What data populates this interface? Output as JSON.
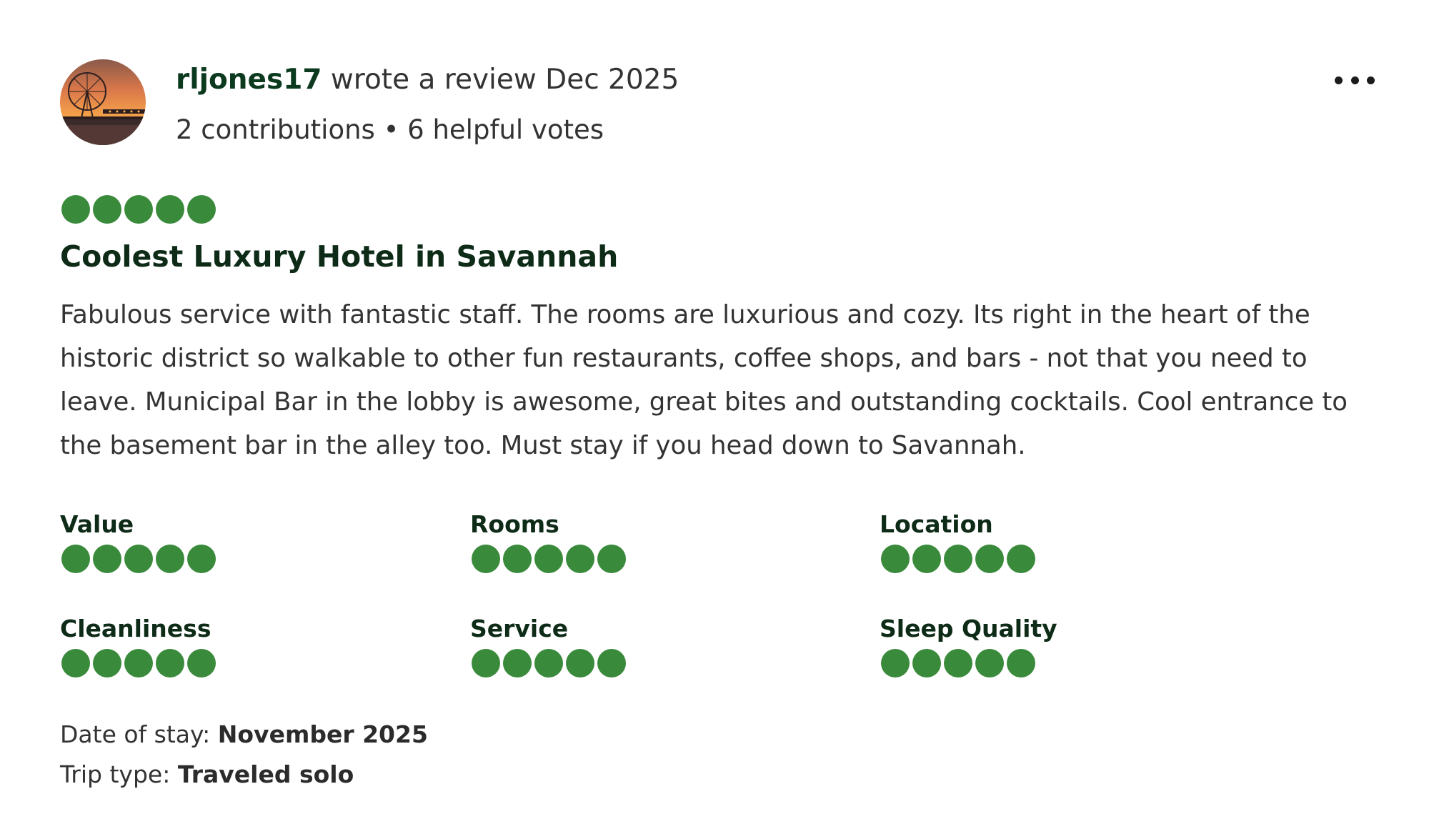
{
  "review": {
    "username": "rljones17",
    "wrote_text": "wrote a review Dec 2025",
    "contributions_text": "2 contributions • 6 helpful votes",
    "overall_rating": 5,
    "rating_max": 5,
    "title": "Coolest Luxury Hotel in Savannah",
    "body": "Fabulous service with fantastic staff. The rooms are luxurious and cozy. Its right in the heart of the historic district so walkable to other fun restaurants, coffee shops, and bars - not that you need to leave. Municipal Bar in the lobby is awesome, great bites and outstanding cocktails. Cool entrance to the basement bar in the alley too. Must stay if you head down to Savannah.",
    "sub_ratings": [
      {
        "label": "Value",
        "rating": 5
      },
      {
        "label": "Rooms",
        "rating": 5
      },
      {
        "label": "Location",
        "rating": 5
      },
      {
        "label": "Cleanliness",
        "rating": 5
      },
      {
        "label": "Service",
        "rating": 5
      },
      {
        "label": "Sleep Quality",
        "rating": 5
      }
    ],
    "date_of_stay_label": "Date of stay:",
    "date_of_stay_value": "November 2025",
    "trip_type_label": "Trip type:",
    "trip_type_value": "Traveled solo"
  },
  "icons": {
    "more": "more-horizontal-icon",
    "avatar": "ferris-wheel-sunset-photo"
  },
  "colors": {
    "bubble_fill": "#3a8a3c",
    "title": "#0d2b17",
    "text": "#333333"
  }
}
